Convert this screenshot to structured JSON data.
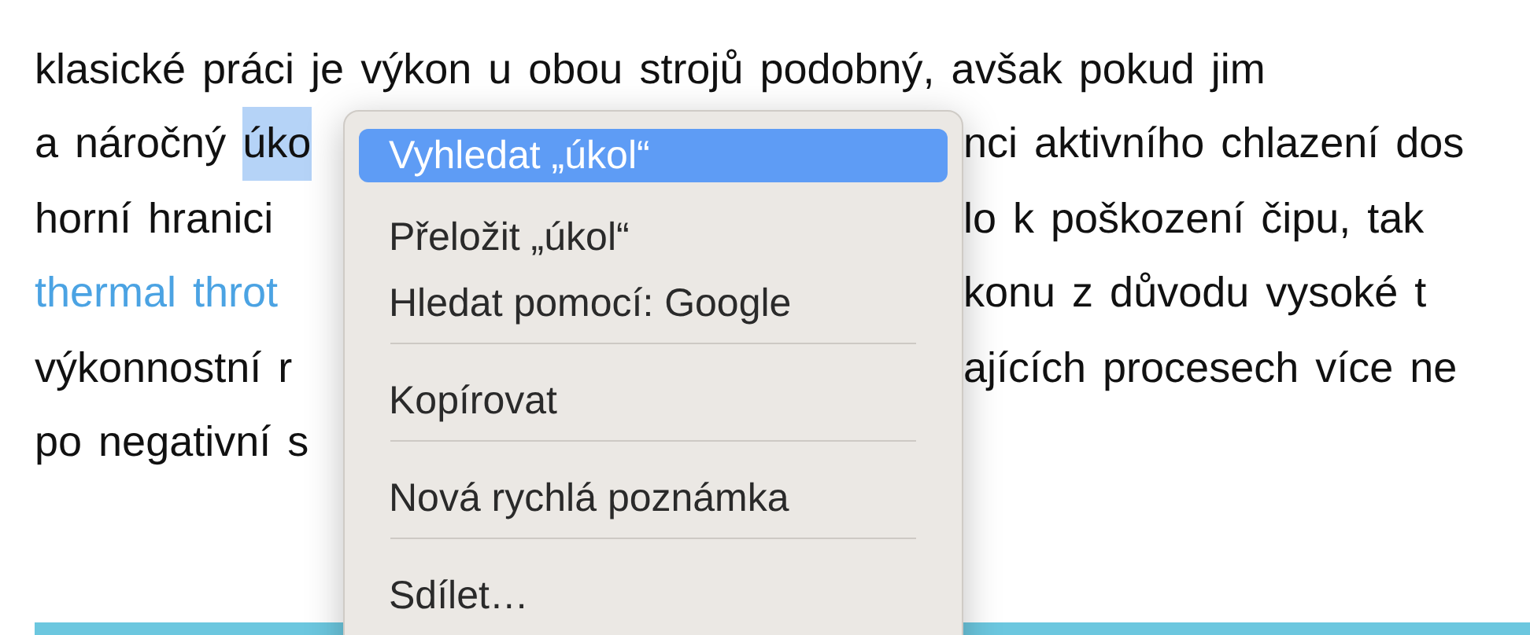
{
  "article": {
    "lines": [
      {
        "left": [
          {
            "kind": "text",
            "text": "klasické práci je výkon u obou strojů podobný, avšak pokud jim"
          }
        ]
      },
      {
        "left": [
          {
            "kind": "text",
            "text": "a náročný "
          },
          {
            "kind": "highlight",
            "text": "úko"
          }
        ],
        "right": "nci aktivního chlazení dos"
      },
      {
        "left": [
          {
            "kind": "text",
            "text": "horní hranici"
          }
        ],
        "right": "lo k poškození čipu, tak"
      },
      {
        "left": [
          {
            "kind": "link",
            "text": "thermal throt"
          }
        ],
        "right": "konu z důvodu vysoké t"
      },
      {
        "left": [
          {
            "kind": "text",
            "text": "výkonnostní r"
          }
        ],
        "right": "ajících procesech více ne"
      },
      {
        "left": [
          {
            "kind": "text",
            "text": "po negativní s"
          }
        ]
      }
    ]
  },
  "context_menu": {
    "items": [
      {
        "kind": "item",
        "label": "Vyhledat „úkol“",
        "selected": true
      },
      {
        "kind": "item",
        "label": "Přeložit „úkol“",
        "selected": false
      },
      {
        "kind": "item",
        "label": "Hledat pomocí: Google",
        "selected": false
      },
      {
        "kind": "separator"
      },
      {
        "kind": "item",
        "label": "Kopírovat",
        "selected": false
      },
      {
        "kind": "separator"
      },
      {
        "kind": "item",
        "label": "Nová rychlá poznámka",
        "selected": false
      },
      {
        "kind": "separator"
      },
      {
        "kind": "item",
        "label": "Sdílet…",
        "selected": false
      }
    ]
  }
}
